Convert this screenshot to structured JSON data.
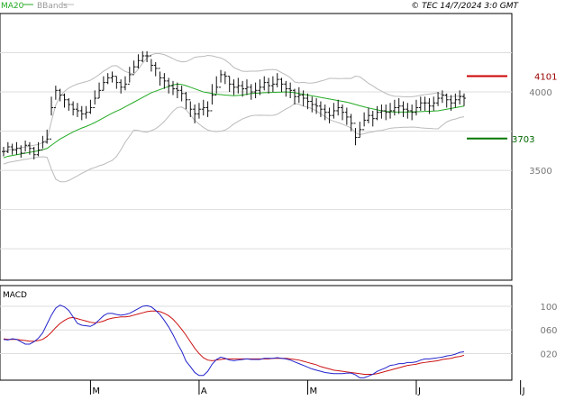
{
  "header": {
    "ma_label": "MA20",
    "bb_label": "BBands",
    "copyright": "© TEC 14/7/2024 3:0 GMT"
  },
  "macd_label": "MACD",
  "colors": {
    "ma": "#22aa22",
    "bands": "#bbbbbb",
    "candle": "#111111",
    "resistance": "#cc0000",
    "support": "#007700",
    "macd": "#2222cc",
    "signal": "#cc1111",
    "grid": "#cccccc",
    "panel_bg": "#ffffff"
  },
  "chart_data": [
    {
      "type": "ohlc",
      "title": "",
      "y_range": [
        2800,
        4500
      ],
      "y_ticks": [
        {
          "value": 4000,
          "label": "4000"
        },
        {
          "value": 3500,
          "label": "3500"
        }
      ],
      "x_ticks": [
        {
          "index": 20,
          "label": "M"
        },
        {
          "index": 45,
          "label": "A"
        },
        {
          "index": 70,
          "label": "M"
        },
        {
          "index": 95,
          "label": "J"
        },
        {
          "index": 119,
          "label": "J"
        }
      ],
      "resistance": {
        "value": 4101,
        "label": "4101"
      },
      "support": {
        "value": 3703,
        "label": "3703"
      },
      "series": [
        {
          "name": "Price",
          "close": [
            3620,
            3650,
            3630,
            3640,
            3610,
            3660,
            3640,
            3600,
            3630,
            3680,
            3700,
            3900,
            4010,
            3980,
            3950,
            3920,
            3890,
            3880,
            3860,
            3870,
            3900,
            3960,
            4010,
            4060,
            4090,
            4100,
            4060,
            4030,
            4050,
            4110,
            4160,
            4200,
            4230,
            4230,
            4170,
            4150,
            4090,
            4070,
            4040,
            4020,
            4010,
            3990,
            3950,
            3890,
            3860,
            3890,
            3900,
            3880,
            3980,
            4030,
            4110,
            4100,
            4050,
            4030,
            4040,
            4020,
            4030,
            4000,
            4010,
            4030,
            4060,
            4040,
            4050,
            4080,
            4050,
            4020,
            4010,
            3970,
            3980,
            3960,
            3940,
            3920,
            3910,
            3890,
            3870,
            3850,
            3880,
            3900,
            3870,
            3840,
            3800,
            3710,
            3760,
            3820,
            3850,
            3830,
            3870,
            3880,
            3870,
            3880,
            3900,
            3910,
            3890,
            3880,
            3870,
            3900,
            3930,
            3930,
            3910,
            3930,
            3960,
            3980,
            3950,
            3930,
            3950,
            3970,
            3960
          ],
          "high": [
            3650,
            3680,
            3670,
            3680,
            3660,
            3690,
            3680,
            3650,
            3680,
            3720,
            3760,
            3970,
            4040,
            4020,
            3990,
            3960,
            3940,
            3930,
            3910,
            3910,
            3950,
            4010,
            4060,
            4100,
            4120,
            4130,
            4100,
            4080,
            4100,
            4160,
            4200,
            4240,
            4260,
            4260,
            4210,
            4190,
            4130,
            4120,
            4090,
            4070,
            4060,
            4040,
            4000,
            3940,
            3920,
            3930,
            3950,
            3940,
            4050,
            4100,
            4140,
            4130,
            4100,
            4080,
            4090,
            4070,
            4080,
            4050,
            4060,
            4080,
            4100,
            4090,
            4100,
            4120,
            4090,
            4070,
            4060,
            4020,
            4030,
            4010,
            3990,
            3970,
            3960,
            3940,
            3920,
            3900,
            3930,
            3950,
            3920,
            3900,
            3860,
            3770,
            3810,
            3870,
            3900,
            3880,
            3910,
            3920,
            3920,
            3930,
            3950,
            3960,
            3940,
            3930,
            3920,
            3950,
            3970,
            3970,
            3960,
            3970,
            4000,
            4010,
            3990,
            3980,
            3990,
            4010,
            3990
          ],
          "low": [
            3590,
            3610,
            3600,
            3600,
            3580,
            3620,
            3600,
            3570,
            3590,
            3640,
            3670,
            3850,
            3950,
            3940,
            3900,
            3880,
            3850,
            3840,
            3820,
            3830,
            3860,
            3920,
            3960,
            4010,
            4050,
            4060,
            4020,
            3990,
            4010,
            4060,
            4120,
            4150,
            4190,
            4190,
            4130,
            4100,
            4040,
            4020,
            3990,
            3980,
            3960,
            3940,
            3890,
            3840,
            3800,
            3830,
            3850,
            3840,
            3920,
            3990,
            4060,
            4050,
            4000,
            3980,
            3990,
            3970,
            3980,
            3950,
            3960,
            3980,
            4010,
            3990,
            4000,
            4030,
            4000,
            3970,
            3960,
            3920,
            3930,
            3910,
            3890,
            3870,
            3860,
            3840,
            3820,
            3800,
            3830,
            3850,
            3820,
            3790,
            3750,
            3660,
            3710,
            3780,
            3800,
            3780,
            3820,
            3830,
            3820,
            3830,
            3850,
            3860,
            3840,
            3830,
            3820,
            3850,
            3880,
            3880,
            3860,
            3880,
            3910,
            3930,
            3900,
            3880,
            3900,
            3920,
            3910
          ]
        },
        {
          "name": "MA20",
          "values": [
            3580,
            3590,
            3595,
            3600,
            3605,
            3610,
            3615,
            3620,
            3625,
            3632,
            3640,
            3660,
            3680,
            3700,
            3715,
            3730,
            3745,
            3758,
            3770,
            3780,
            3792,
            3805,
            3820,
            3835,
            3850,
            3865,
            3878,
            3890,
            3905,
            3920,
            3935,
            3950,
            3965,
            3980,
            3995,
            4005,
            4015,
            4025,
            4035,
            4045,
            4050,
            4048,
            4040,
            4030,
            4020,
            4010,
            4000,
            3995,
            3990,
            3985,
            3983,
            3980,
            3978,
            3976,
            3978,
            3980,
            3985,
            3990,
            3992,
            3993,
            3995,
            3996,
            3997,
            3998,
            3999,
            4000,
            3998,
            3995,
            3990,
            3985,
            3980,
            3975,
            3970,
            3965,
            3960,
            3955,
            3950,
            3945,
            3940,
            3935,
            3928,
            3920,
            3912,
            3905,
            3898,
            3892,
            3886,
            3880,
            3876,
            3874,
            3872,
            3872,
            3872,
            3872,
            3873,
            3874,
            3875,
            3876,
            3877,
            3878,
            3880,
            3885,
            3890,
            3895,
            3900,
            3905,
            3910
          ]
        }
      ]
    },
    {
      "type": "line",
      "title": "",
      "y_range": [
        -0.25,
        1.35
      ],
      "y_ticks": [
        {
          "value": 1.0,
          "label": "100"
        },
        {
          "value": 0.6,
          "label": "060"
        },
        {
          "value": 0.2,
          "label": "020"
        }
      ],
      "series": [
        {
          "name": "MACD",
          "values": [
            0.44,
            0.43,
            0.45,
            0.44,
            0.4,
            0.36,
            0.36,
            0.4,
            0.46,
            0.55,
            0.7,
            0.85,
            0.97,
            1.02,
            0.99,
            0.93,
            0.82,
            0.71,
            0.68,
            0.67,
            0.66,
            0.7,
            0.77,
            0.84,
            0.88,
            0.88,
            0.86,
            0.85,
            0.86,
            0.88,
            0.92,
            0.96,
            1.0,
            1.01,
            0.99,
            0.93,
            0.86,
            0.76,
            0.65,
            0.52,
            0.37,
            0.24,
            0.07,
            -0.02,
            -0.12,
            -0.17,
            -0.17,
            -0.1,
            0.02,
            0.1,
            0.14,
            0.12,
            0.09,
            0.08,
            0.09,
            0.1,
            0.11,
            0.1,
            0.1,
            0.1,
            0.12,
            0.12,
            0.12,
            0.13,
            0.12,
            0.11,
            0.09,
            0.06,
            0.03,
            0.0,
            -0.03,
            -0.06,
            -0.08,
            -0.1,
            -0.12,
            -0.13,
            -0.14,
            -0.14,
            -0.14,
            -0.13,
            -0.13,
            -0.16,
            -0.21,
            -0.21,
            -0.18,
            -0.15,
            -0.1,
            -0.07,
            -0.04,
            0.0,
            0.01,
            0.03,
            0.03,
            0.05,
            0.05,
            0.06,
            0.09,
            0.11,
            0.11,
            0.12,
            0.13,
            0.14,
            0.16,
            0.17,
            0.19,
            0.22,
            0.23
          ]
        },
        {
          "name": "Signal",
          "values": [
            0.45,
            0.44,
            0.44,
            0.44,
            0.43,
            0.42,
            0.41,
            0.41,
            0.42,
            0.44,
            0.49,
            0.56,
            0.64,
            0.71,
            0.76,
            0.8,
            0.81,
            0.79,
            0.77,
            0.75,
            0.73,
            0.72,
            0.73,
            0.75,
            0.78,
            0.8,
            0.81,
            0.82,
            0.82,
            0.83,
            0.85,
            0.87,
            0.89,
            0.91,
            0.92,
            0.92,
            0.91,
            0.88,
            0.84,
            0.78,
            0.7,
            0.61,
            0.51,
            0.4,
            0.29,
            0.2,
            0.13,
            0.09,
            0.08,
            0.09,
            0.1,
            0.11,
            0.11,
            0.11,
            0.11,
            0.11,
            0.11,
            0.11,
            0.11,
            0.11,
            0.11,
            0.11,
            0.12,
            0.12,
            0.12,
            0.12,
            0.11,
            0.1,
            0.09,
            0.07,
            0.05,
            0.03,
            0.01,
            -0.02,
            -0.04,
            -0.06,
            -0.08,
            -0.09,
            -0.1,
            -0.11,
            -0.12,
            -0.13,
            -0.14,
            -0.15,
            -0.15,
            -0.15,
            -0.14,
            -0.12,
            -0.1,
            -0.08,
            -0.06,
            -0.04,
            -0.02,
            0.0,
            0.01,
            0.02,
            0.04,
            0.05,
            0.06,
            0.07,
            0.08,
            0.1,
            0.11,
            0.12,
            0.14,
            0.15,
            0.17
          ]
        }
      ]
    }
  ]
}
